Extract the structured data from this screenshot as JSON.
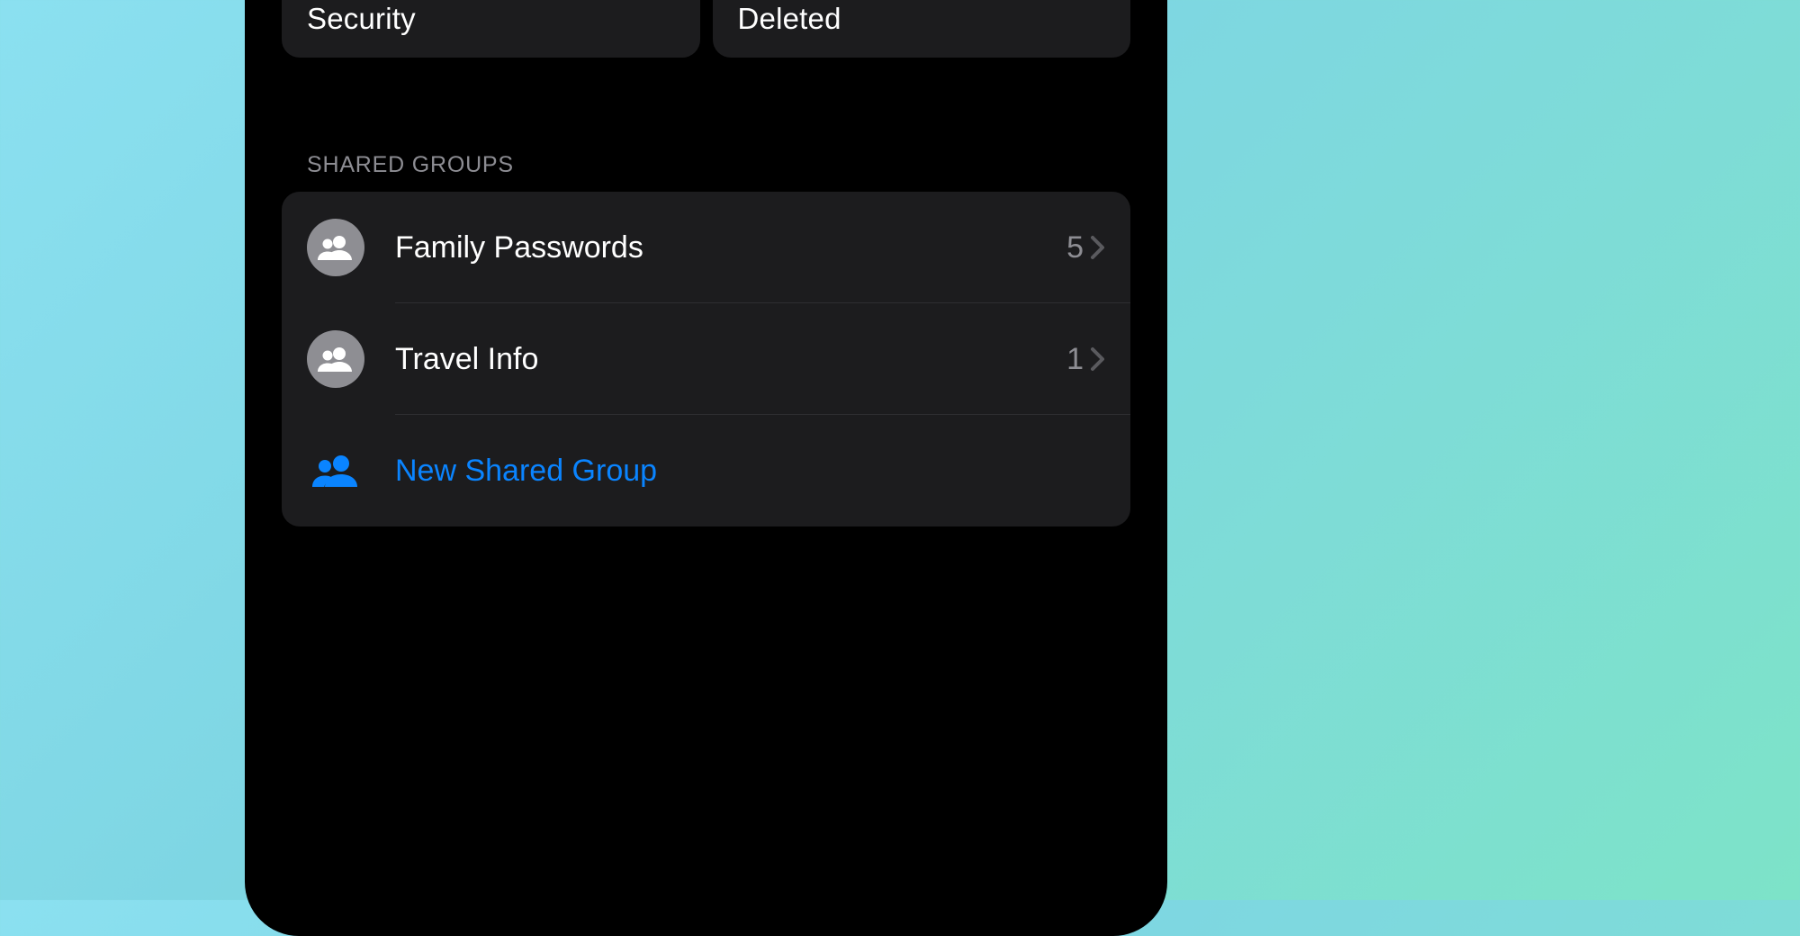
{
  "cards": {
    "security": {
      "label": "Security",
      "icon_color": "#ff3b30"
    },
    "deleted": {
      "label": "Deleted",
      "icon_color": "#ff9500"
    }
  },
  "shared_groups": {
    "header": "SHARED GROUPS",
    "items": [
      {
        "label": "Family Passwords",
        "count": "5"
      },
      {
        "label": "Travel Info",
        "count": "1"
      }
    ],
    "new_label": "New Shared Group",
    "accent_color": "#0a84ff"
  }
}
